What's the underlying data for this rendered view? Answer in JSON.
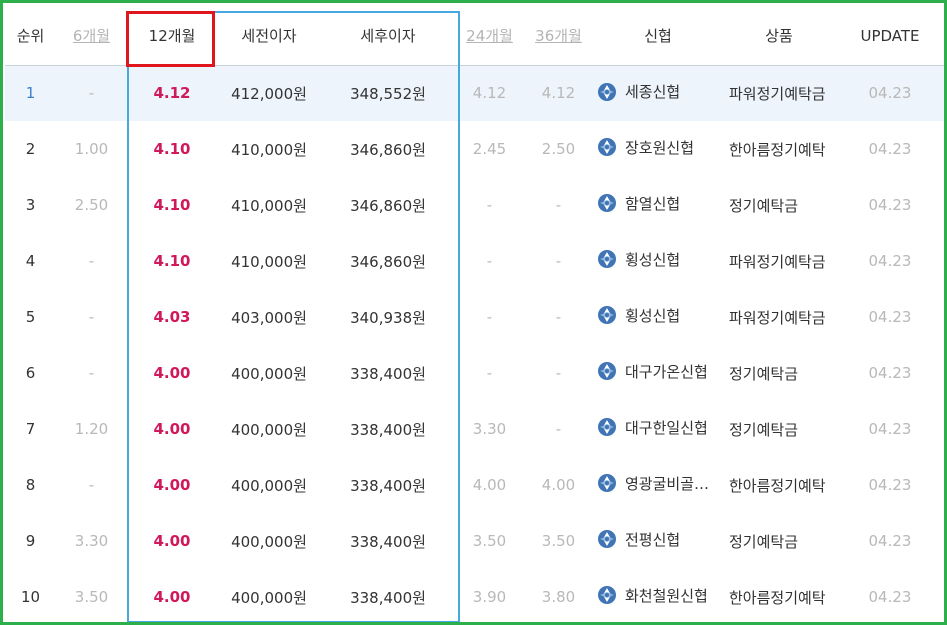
{
  "header": {
    "rank": "순위",
    "m6": "6개월",
    "m12": "12개월",
    "pretax": "세전이자",
    "aftertax": "세후이자",
    "m24": "24개월",
    "m36": "36개월",
    "bank": "신협",
    "product": "상품",
    "update": "UPDATE"
  },
  "rows": [
    {
      "rank": "1",
      "m6": "-",
      "m12": "4.12",
      "pretax": "412,000원",
      "aftertax": "348,552원",
      "m24": "4.12",
      "m36": "4.12",
      "bank": "세종신협",
      "product": "파워정기예탁금",
      "update": "04.23"
    },
    {
      "rank": "2",
      "m6": "1.00",
      "m12": "4.10",
      "pretax": "410,000원",
      "aftertax": "346,860원",
      "m24": "2.45",
      "m36": "2.50",
      "bank": "장호원신협",
      "product": "한아름정기예탁",
      "update": "04.23"
    },
    {
      "rank": "3",
      "m6": "2.50",
      "m12": "4.10",
      "pretax": "410,000원",
      "aftertax": "346,860원",
      "m24": "-",
      "m36": "-",
      "bank": "함열신협",
      "product": "정기예탁금",
      "update": "04.23"
    },
    {
      "rank": "4",
      "m6": "-",
      "m12": "4.10",
      "pretax": "410,000원",
      "aftertax": "346,860원",
      "m24": "-",
      "m36": "-",
      "bank": "횡성신협",
      "product": "파워정기예탁금",
      "update": "04.23"
    },
    {
      "rank": "5",
      "m6": "-",
      "m12": "4.03",
      "pretax": "403,000원",
      "aftertax": "340,938원",
      "m24": "-",
      "m36": "-",
      "bank": "횡성신협",
      "product": "파워정기예탁금",
      "update": "04.23"
    },
    {
      "rank": "6",
      "m6": "-",
      "m12": "4.00",
      "pretax": "400,000원",
      "aftertax": "338,400원",
      "m24": "-",
      "m36": "-",
      "bank": "대구가온신협",
      "product": "정기예탁금",
      "update": "04.23"
    },
    {
      "rank": "7",
      "m6": "1.20",
      "m12": "4.00",
      "pretax": "400,000원",
      "aftertax": "338,400원",
      "m24": "3.30",
      "m36": "-",
      "bank": "대구한일신협",
      "product": "정기예탁금",
      "update": "04.23"
    },
    {
      "rank": "8",
      "m6": "-",
      "m12": "4.00",
      "pretax": "400,000원",
      "aftertax": "338,400원",
      "m24": "4.00",
      "m36": "4.00",
      "bank": "영광굴비골…",
      "product": "한아름정기예탁",
      "update": "04.23"
    },
    {
      "rank": "9",
      "m6": "3.30",
      "m12": "4.00",
      "pretax": "400,000원",
      "aftertax": "338,400원",
      "m24": "3.50",
      "m36": "3.50",
      "bank": "전평신협",
      "product": "정기예탁금",
      "update": "04.23"
    },
    {
      "rank": "10",
      "m6": "3.50",
      "m12": "4.00",
      "pretax": "400,000원",
      "aftertax": "338,400원",
      "m24": "3.90",
      "m36": "3.80",
      "bank": "화천철원신협",
      "product": "한아름정기예탁",
      "update": "04.23"
    }
  ],
  "highlight_row": 0,
  "icon": "credit-union-logo-icon",
  "colors": {
    "rate": "#d0185a",
    "frame": "#2db04b",
    "blue_box": "#47a8e0",
    "red_box": "#e0161d",
    "highlight": "#eef4fb"
  }
}
